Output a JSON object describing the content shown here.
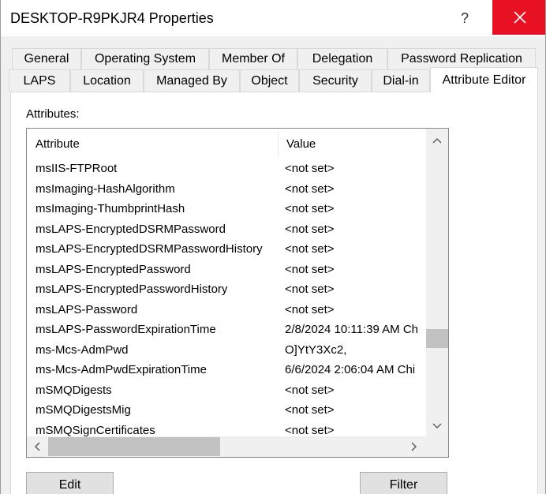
{
  "window": {
    "title": "DESKTOP-R9PKJR4 Properties",
    "help_label": "?",
    "close_icon": "close-icon",
    "close_color": "#e81123"
  },
  "tabs": {
    "row1": [
      "General",
      "Operating System",
      "Member Of",
      "Delegation",
      "Password Replication"
    ],
    "row2": [
      "LAPS",
      "Location",
      "Managed By",
      "Object",
      "Security",
      "Dial-in",
      "Attribute Editor"
    ],
    "active": "Attribute Editor"
  },
  "attributes_label": "Attributes:",
  "list": {
    "columns": [
      "Attribute",
      "Value"
    ],
    "rows": [
      {
        "attribute": "msIIS-FTPRoot",
        "value": "<not set>"
      },
      {
        "attribute": "msImaging-HashAlgorithm",
        "value": "<not set>"
      },
      {
        "attribute": "msImaging-ThumbprintHash",
        "value": "<not set>"
      },
      {
        "attribute": "msLAPS-EncryptedDSRMPassword",
        "value": "<not set>"
      },
      {
        "attribute": "msLAPS-EncryptedDSRMPasswordHistory",
        "value": "<not set>"
      },
      {
        "attribute": "msLAPS-EncryptedPassword",
        "value": "<not set>"
      },
      {
        "attribute": "msLAPS-EncryptedPasswordHistory",
        "value": "<not set>"
      },
      {
        "attribute": "msLAPS-Password",
        "value": "<not set>"
      },
      {
        "attribute": "msLAPS-PasswordExpirationTime",
        "value": "2/8/2024 10:11:39 AM Ch"
      },
      {
        "attribute": "ms-Mcs-AdmPwd",
        "value": "O]YtY3Xc2,"
      },
      {
        "attribute": "ms-Mcs-AdmPwdExpirationTime",
        "value": "6/6/2024 2:06:04 AM Chi"
      },
      {
        "attribute": "mSMQDigests",
        "value": "<not set>"
      },
      {
        "attribute": "mSMQDigestsMig",
        "value": "<not set>"
      },
      {
        "attribute": "mSMQSignCertificates",
        "value": "<not set>"
      }
    ]
  },
  "buttons": {
    "edit": "Edit",
    "filter": "Filter"
  }
}
